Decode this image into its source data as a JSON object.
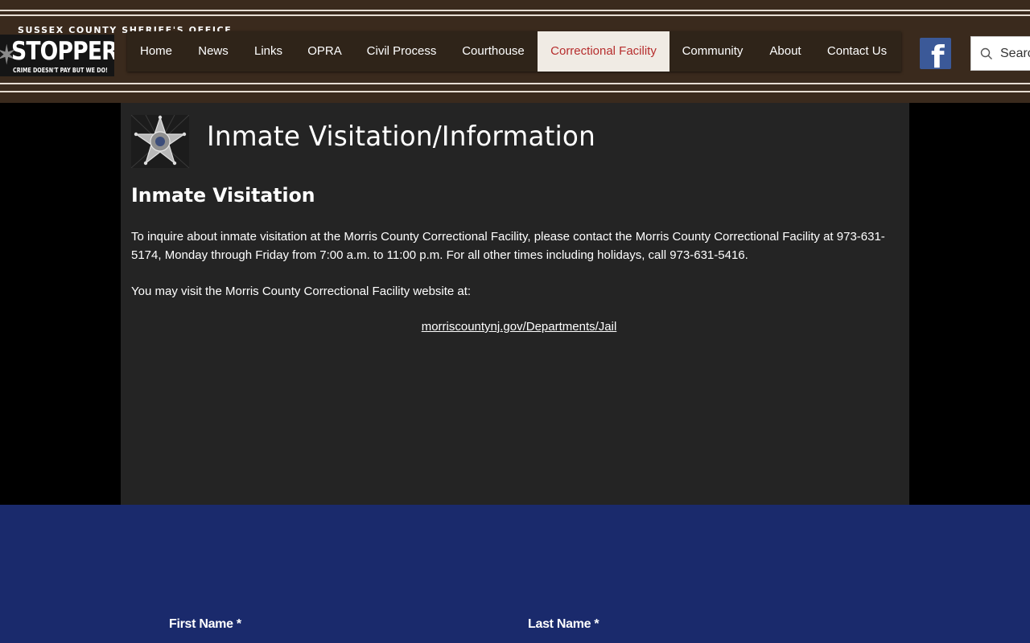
{
  "header": {
    "org_title": "SUSSEX COUNTY SHERIFF'S OFFICE",
    "logo": {
      "main": "STOPPERS",
      "sub": "CRIME DOESN'T PAY BUT WE DO!"
    },
    "nav": [
      {
        "label": "Home"
      },
      {
        "label": "News"
      },
      {
        "label": "Links"
      },
      {
        "label": "OPRA"
      },
      {
        "label": "Civil Process"
      },
      {
        "label": "Courthouse"
      },
      {
        "label": "Correctional Facility",
        "active": true
      },
      {
        "label": "Community"
      },
      {
        "label": "About"
      },
      {
        "label": "Contact Us"
      }
    ],
    "facebook_icon": "facebook-icon",
    "search": {
      "placeholder": "Search..."
    }
  },
  "main": {
    "page_title": "Inmate Visitation/Information",
    "section_title": "Inmate Visitation",
    "paragraph_1": "To inquire about inmate visitation at the Morris County Correctional Facility, please contact the Morris County Correctional Facility at 973-631-5174, Monday through Friday from 7:00 a.m. to 11:00 p.m. For all other times including holidays, call 973-631-5416.",
    "paragraph_2": "You may visit the Morris County Correctional Facility website at:",
    "link_text": "morriscountynj.gov/Departments/Jail "
  },
  "form": {
    "first_name_label": "First Name *",
    "last_name_label": "Last Name *"
  },
  "colors": {
    "header_bg": "#3a2a1d",
    "nav_active_text": "#b62d2d",
    "panel_bg": "#242424",
    "footer_bg": "#1a2a6c",
    "facebook": "#3b5998"
  }
}
